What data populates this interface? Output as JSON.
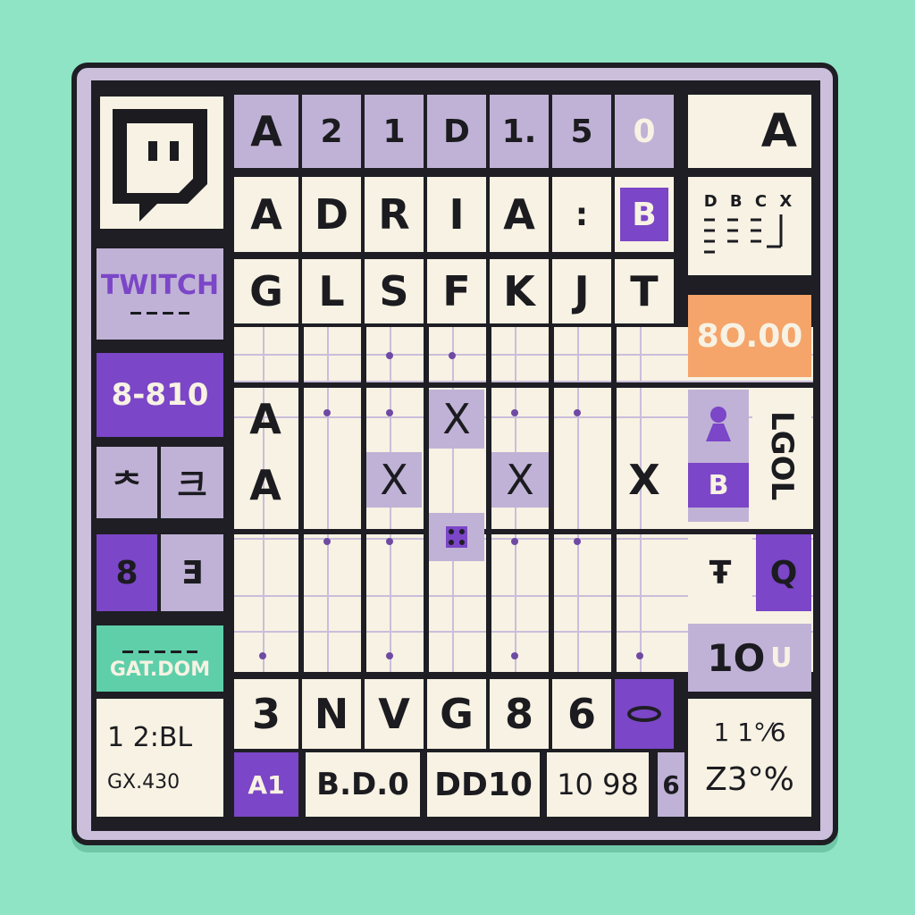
{
  "colors": {
    "background": "#8ee4c4",
    "board": "#cbbfdc",
    "purple": "#7b46c7",
    "lilac": "#c0b2d6",
    "cream": "#f7f2e3",
    "orange": "#f5a46a",
    "teal": "#5fcfaa",
    "ink": "#1e1e24"
  },
  "logo": {
    "icon": "twitch-glitch-icon",
    "wordmark": "TWITCH"
  },
  "top_row": [
    "A",
    "2",
    "1",
    "D",
    "1.",
    "5",
    "0"
  ],
  "top_right": "A",
  "row2": [
    "A",
    "D",
    "R",
    "I",
    "A",
    ":",
    "B"
  ],
  "legend_tile": {
    "header": "D B C X"
  },
  "row3": [
    "G",
    "L",
    "S",
    "F",
    "K",
    "J",
    "T"
  ],
  "side_left": {
    "score": "8-810",
    "glyph_a": "ᄎ",
    "glyph_b": "크",
    "glyph_c": "8",
    "glyph_d": "Ǝ",
    "domain": "GAT.DOM",
    "info_line1": "1 2:BL",
    "info_line2": "GX.430"
  },
  "side_right": {
    "score": "8O.00",
    "pawn_label": "B",
    "vertical": "LGOL",
    "glyph": "Ŧ",
    "q": "Q",
    "ten": "1O",
    "u": "U",
    "stat1": "1 1°⁄6",
    "stat2": "Z3°%"
  },
  "mid_cells": {
    "a1": "A",
    "a2": "A",
    "x1": "X",
    "x2": "X",
    "x3": "X",
    "x4": "X"
  },
  "bottom_row": [
    "3",
    "N",
    "V",
    "G",
    "8",
    "6"
  ],
  "footer": {
    "a1": "A1",
    "b": "B.D.0",
    "dd": "DD10",
    "num": "10 98",
    "six": "6"
  }
}
